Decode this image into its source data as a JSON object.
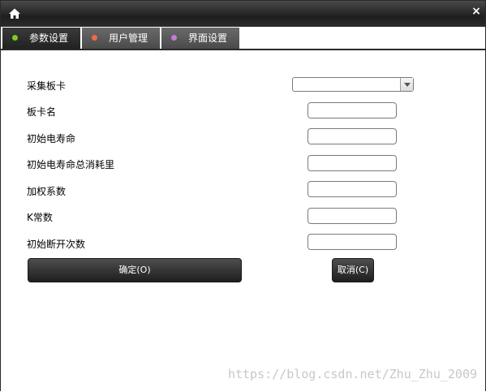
{
  "window": {
    "home_icon": "home-icon",
    "close_glyph": "×"
  },
  "tabs": [
    {
      "label": "参数设置",
      "dot_color": "#7ccc1c",
      "active": true
    },
    {
      "label": "用户管理",
      "dot_color": "#f06a4a",
      "active": false
    },
    {
      "label": "界面设置",
      "dot_color": "#c77ad6",
      "active": false
    }
  ],
  "form": {
    "fields": [
      {
        "label": "采集板卡",
        "type": "select",
        "value": ""
      },
      {
        "label": "板卡名",
        "type": "text",
        "value": ""
      },
      {
        "label": "初始电寿命",
        "type": "text",
        "value": ""
      },
      {
        "label": "初始电寿命总消耗里",
        "type": "text",
        "value": ""
      },
      {
        "label": "加权系数",
        "type": "text",
        "value": ""
      },
      {
        "label": "K常数",
        "type": "text",
        "value": ""
      },
      {
        "label": "初始断开次数",
        "type": "text",
        "value": ""
      }
    ],
    "confirm_label": "确定(O)",
    "cancel_label": "取消(C)"
  },
  "watermark": "https://blog.csdn.net/Zhu_Zhu_2009",
  "colors": {
    "titlebar": "#2b2b2b",
    "button": "#2e2e2e"
  }
}
